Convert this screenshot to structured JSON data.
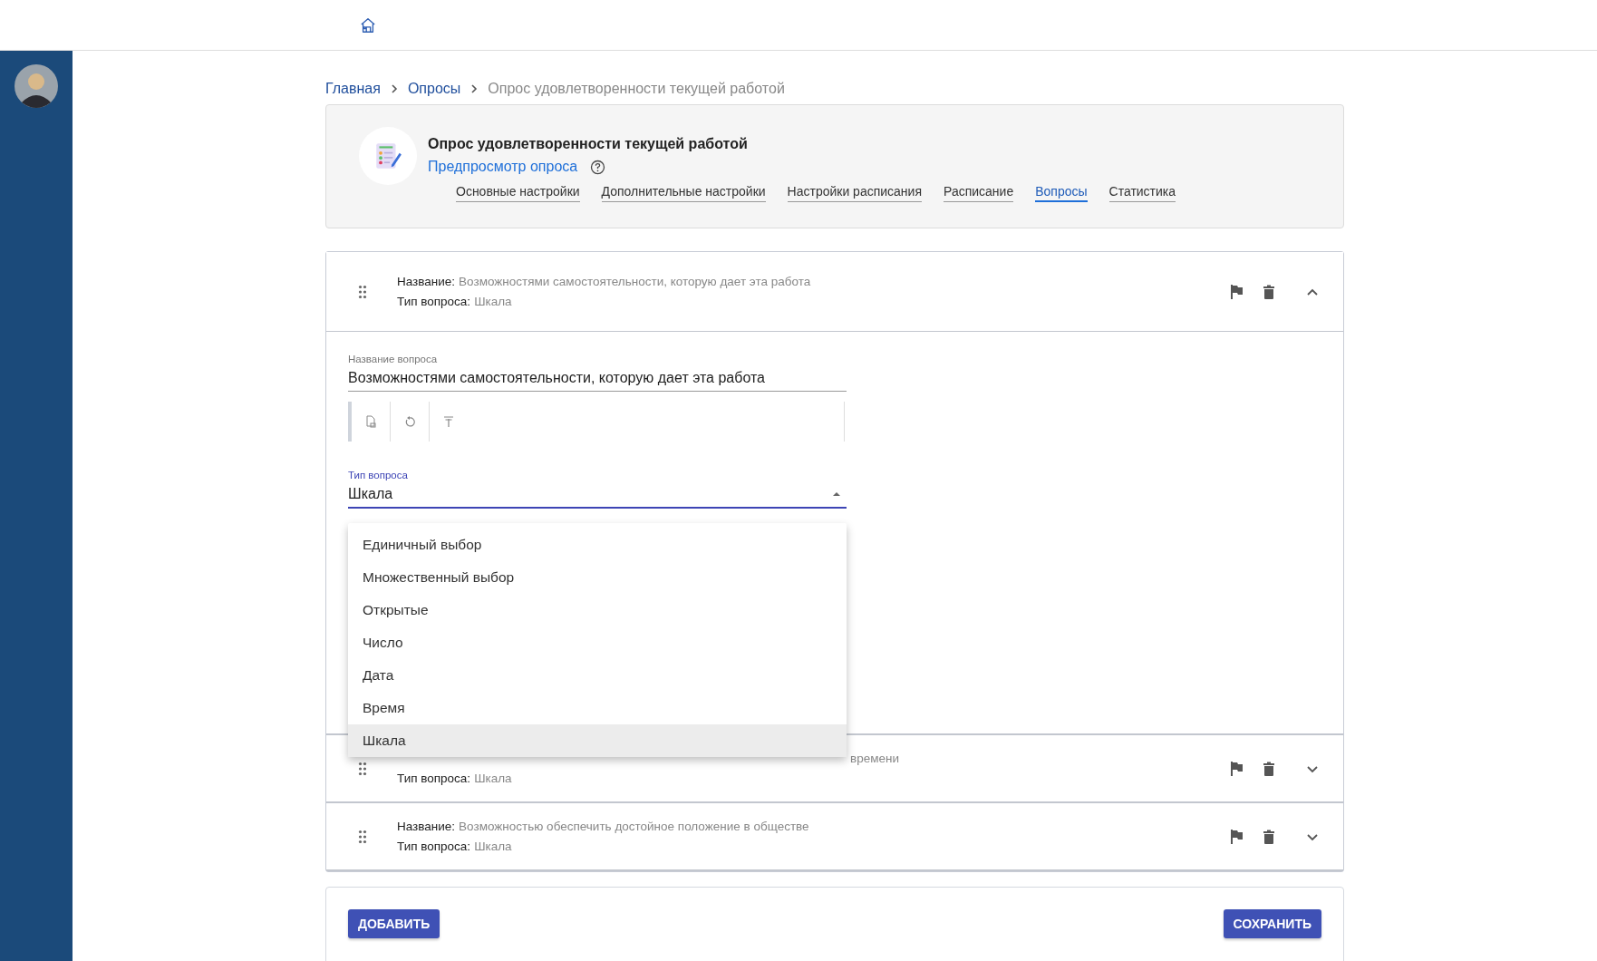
{
  "breadcrumbs": [
    {
      "label": "Главная",
      "current": false
    },
    {
      "label": "Опросы",
      "current": false
    },
    {
      "label": "Опрос удовлетворенности текущей работой",
      "current": true
    }
  ],
  "survey": {
    "title": "Опрос удовлетворенности текущей работой",
    "preview_link": "Предпросмотр опроса",
    "tabs": [
      {
        "label": "Основные настройки",
        "selected": false
      },
      {
        "label": "Дополнительные настройки",
        "selected": false
      },
      {
        "label": "Настройки расписания",
        "selected": false
      },
      {
        "label": "Расписание",
        "selected": false
      },
      {
        "label": "Вопросы",
        "selected": true
      },
      {
        "label": "Статистика",
        "selected": false
      }
    ]
  },
  "questions": [
    {
      "name_label": "Название:",
      "name": "Возможностями самостоятельности, которую дает эта работа",
      "type_label": "Тип вопроса:",
      "type": "Шкала",
      "expanded": true
    },
    {
      "name": "времени",
      "type_label": "Тип вопроса:",
      "type": "Шкала",
      "expanded": false
    },
    {
      "name_label": "Название:",
      "name": "Возможностью обеспечить достойное положение в обществе",
      "type_label": "Тип вопроса:",
      "type": "Шкала",
      "expanded": false
    }
  ],
  "editor": {
    "name_field": {
      "label": "Название вопроса",
      "value": "Возможностями самостоятельности, которую дает эта работа"
    },
    "type_field": {
      "label": "Тип вопроса",
      "value": "Шкала",
      "open": true
    },
    "options": [
      {
        "label": "Единичный выбор",
        "selected": false
      },
      {
        "label": "Множественный выбор",
        "selected": false
      },
      {
        "label": "Открытые",
        "selected": false
      },
      {
        "label": "Число",
        "selected": false
      },
      {
        "label": "Дата",
        "selected": false
      },
      {
        "label": "Время",
        "selected": false
      },
      {
        "label": "Шкала",
        "selected": true
      }
    ]
  },
  "buttons": {
    "add": "ДОБАВИТЬ",
    "save": "СОХРАНИТЬ"
  }
}
